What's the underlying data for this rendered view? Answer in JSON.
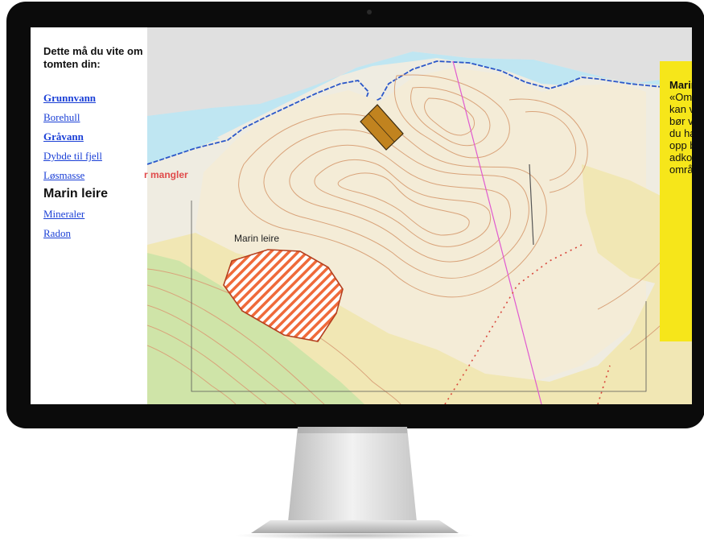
{
  "sidebar": {
    "heading": "Dette må du vite om tomten din:",
    "items": [
      {
        "label": "Grunnvann",
        "bold": true
      },
      {
        "label": "Borehull",
        "bold": false
      },
      {
        "label": "Gråvann",
        "bold": true
      },
      {
        "label": "Dybde til fjell",
        "bold": false
      },
      {
        "label": "Løsmasse",
        "bold": false
      }
    ],
    "current": "Marin leire",
    "items_after": [
      {
        "label": "Mineraler"
      },
      {
        "label": "Radon"
      }
    ]
  },
  "map": {
    "label_cutoff": "r mangler",
    "label_area": "Marin leire"
  },
  "info_box": {
    "title": "Marin leire:",
    "text": "«Områder med marin leire kan være utsatt for ras. Du bør vurdere rasfaren om du har planer om å sette opp bygninger eller legge adkomstvei over dette området.»"
  },
  "colors": {
    "link": "#1a3fd6",
    "info_box_bg": "#f6e61a",
    "water": "#b8e4f0",
    "land": "#f3efdc",
    "contour": "#d69a6a",
    "hatch": "#ef6a3a"
  }
}
